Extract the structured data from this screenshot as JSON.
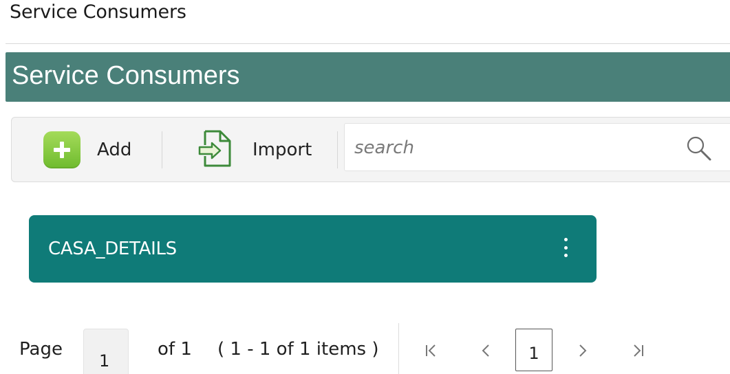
{
  "page": {
    "title": "Service Consumers"
  },
  "banner": {
    "title": "Service Consumers",
    "color": "#4a8079"
  },
  "toolbar": {
    "add_label": "Add",
    "import_label": "Import",
    "search": {
      "placeholder": "search",
      "value": ""
    }
  },
  "cards": [
    {
      "name": "CASA_DETAILS",
      "color": "#0f7b78"
    }
  ],
  "pagination": {
    "page_label": "Page",
    "page_input_value": "1",
    "of_label": "of 1",
    "range_label": "( 1 - 1 of 1 items )",
    "current_page": "1"
  },
  "icons": {
    "add": "plus-icon",
    "import": "import-icon",
    "search": "search-icon",
    "more": "kebab-menu-icon",
    "first": "first-page-icon",
    "prev": "previous-page-icon",
    "next": "next-page-icon",
    "last": "last-page-icon"
  }
}
